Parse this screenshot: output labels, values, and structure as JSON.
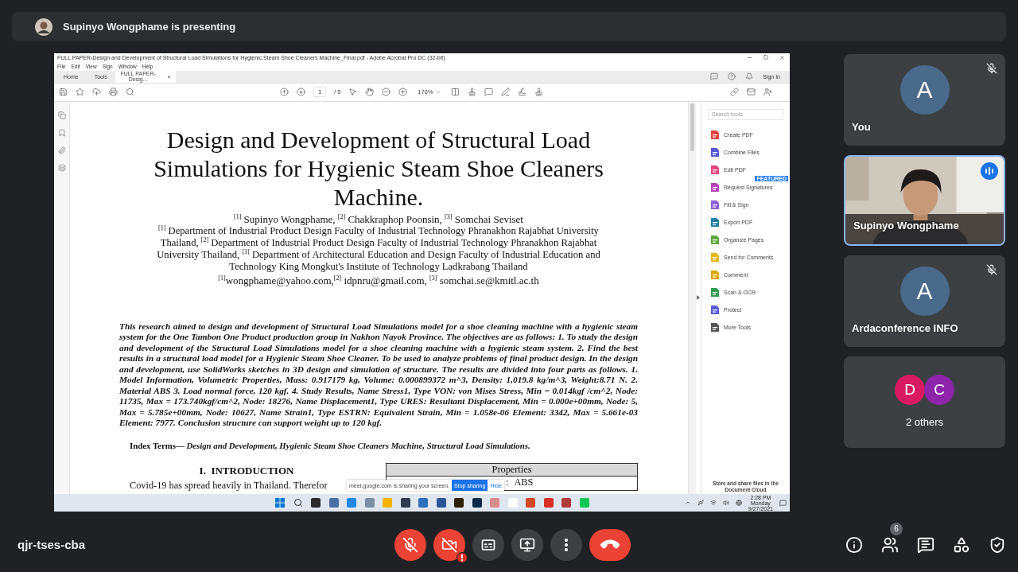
{
  "presenter_bar": {
    "text": "Supinyo Wongphame is presenting"
  },
  "shared_screen": {
    "window_title": "FULL PAPER-Design and Development of Structural Load Simulations for Hygienic Steam Shoe Cleaners Machine_Final.pdf - Adobe Acrobat Pro DC (32-bit)",
    "menu": [
      "File",
      "Edit",
      "View",
      "Sign",
      "Window",
      "Help"
    ],
    "tabs": [
      {
        "label": "Home",
        "selected": false,
        "closable": false
      },
      {
        "label": "Tools",
        "selected": false,
        "closable": false
      },
      {
        "label": "FULL PAPER-Desig...",
        "selected": true,
        "closable": true
      }
    ],
    "close_glyph": "×",
    "sign_in": "Sign In",
    "page_number": "1",
    "page_count": "/ 5",
    "zoom": "176%",
    "document": {
      "title": "Design and Development of Structural Load Simulations for Hygienic Steam Shoe Cleaners Machine.",
      "authors": "$^{[1]}$ Supinyo Wongphame, $^{[2]}$ Chakkraphop Poonsin, $^{[3]}$ Somchai Seviset",
      "affiliations": "$^{[1]}$ Department of Industrial Product Design Faculty of Industrial Technology Phranakhon Rajabhat University Thailand, $^{[2]}$ Department of Industrial Product Design Faculty of Industrial Technology Phranakhon Rajabhat University Thailand, $^{[3]}$ Department of Architectural Education and Design Faculty of Industrial Education and Technology King Mongkut's Institute of Technology Ladkrabang Thailand",
      "emails": "$^{[1]}$wongphame@yahoo.com,$^{[2]}$ idpnru@gmail.com, $^{[3]}$ somchai.se@kmitl.ac.th",
      "abstract": "This research aimed to design and development of Structural Load Simulations model for a shoe cleaning machine with a hygienic steam system for the One Tambon One Product production group in Nakhon Nayok Province. The objectives are as follows: 1. To study the design and development of the Structural Load Simulations model for a shoe cleaning machine with a hygienic steam system. 2. Find the best results in a structural load model for a Hygienic Steam Shoe Cleaner. To be used to analyze problems of final product design. In the design and development, use SolidWorks sketches in 3D design and simulation of structure. The results are divided into four parts as follows. 1. Model Information, Volumetric Properties, Mass: 0.917179 kg, Volume: 0.000899372 m^3, Density: 1,019.8 kg/m^3, Weight:8.71 N. 2. Material ABS 3. Load normal force, 120 kgf. 4. Study Results, Name Stress1, Type VON: von Mises Stress, Min = 0.014kgf /cm^2, Node: 11735, Max = 173.740kgf/cm^2, Node: 18276, Name Displacement1, Type URES: Resultant Displacement, Min = 0.000e+00mm, Node: 5, Max = 5.785e+00mm, Node: 10627, Name Strain1, Type ESTRN: Equivalent Strain, Min = 1.058e-06 Element: 3342, Max = 5.661e-03 Element: 7977. Conclusion structure can support weight up to 120 kgf.",
      "index_terms": "Index Terms— *Design and Development, Hygienic Steam Shoe Cleaners Machine, Structural Load Simulations.*",
      "section_heading": "I.  INTRODUCTION",
      "body_text": "Covid-19 has spread heavily in Thailand. Therefor",
      "table": {
        "header": "Properties",
        "column_1": ":",
        "column_2": "ABS"
      }
    },
    "tools_panel": {
      "search_placeholder": "Search tools",
      "items": [
        {
          "label": "Create PDF",
          "color": "#e0443e"
        },
        {
          "label": "Combine Files",
          "color": "#5258d9"
        },
        {
          "label": "Edit PDF",
          "color": "#e0457b"
        },
        {
          "label": "Request Signatures",
          "color": "#b545b8",
          "badge": "FEATURED"
        },
        {
          "label": "Fill & Sign",
          "color": "#8c5fd6"
        },
        {
          "label": "Export PDF",
          "color": "#1f7fa6"
        },
        {
          "label": "Organize Pages",
          "color": "#5fa83c"
        },
        {
          "label": "Send for Comments",
          "color": "#e6b516"
        },
        {
          "label": "Comment",
          "color": "#e0a800"
        },
        {
          "label": "Scan & OCR",
          "color": "#2e9e4e"
        },
        {
          "label": "Protect",
          "color": "#5a5ad6"
        },
        {
          "label": "More Tools",
          "color": "#555555"
        }
      ],
      "footer": "Store and share files in the Document Cloud"
    },
    "share_notice": {
      "text": "meet.google.com is sharing your screen.",
      "stop": "Stop sharing",
      "hide": "Hide"
    },
    "taskbar": {
      "time": "2:28 PM",
      "day": "Monday",
      "date": "9/27/2021"
    }
  },
  "participants": [
    {
      "kind": "avatar",
      "name": "You",
      "initial": "A",
      "muted": true,
      "speaking": false
    },
    {
      "kind": "video",
      "name": "Supinyo Wongphame",
      "muted": false,
      "speaking": true
    },
    {
      "kind": "avatar",
      "name": "Ardaconference INFO",
      "initial": "A",
      "muted": true,
      "speaking": false
    },
    {
      "kind": "group",
      "name": "2 others",
      "initials": [
        {
          "letter": "D",
          "color": "#d81b60"
        },
        {
          "letter": "C",
          "color": "#8e24aa"
        }
      ]
    }
  ],
  "meeting_code": "qjr-tses-cba",
  "controls": [
    {
      "kind": "mic",
      "on": false
    },
    {
      "kind": "camera",
      "on": false,
      "alert": true
    },
    {
      "kind": "captions"
    },
    {
      "kind": "present"
    },
    {
      "kind": "more"
    },
    {
      "kind": "end"
    }
  ],
  "side_controls": [
    {
      "kind": "info"
    },
    {
      "kind": "people",
      "badge": "6"
    },
    {
      "kind": "chat"
    },
    {
      "kind": "activities"
    },
    {
      "kind": "host"
    }
  ]
}
